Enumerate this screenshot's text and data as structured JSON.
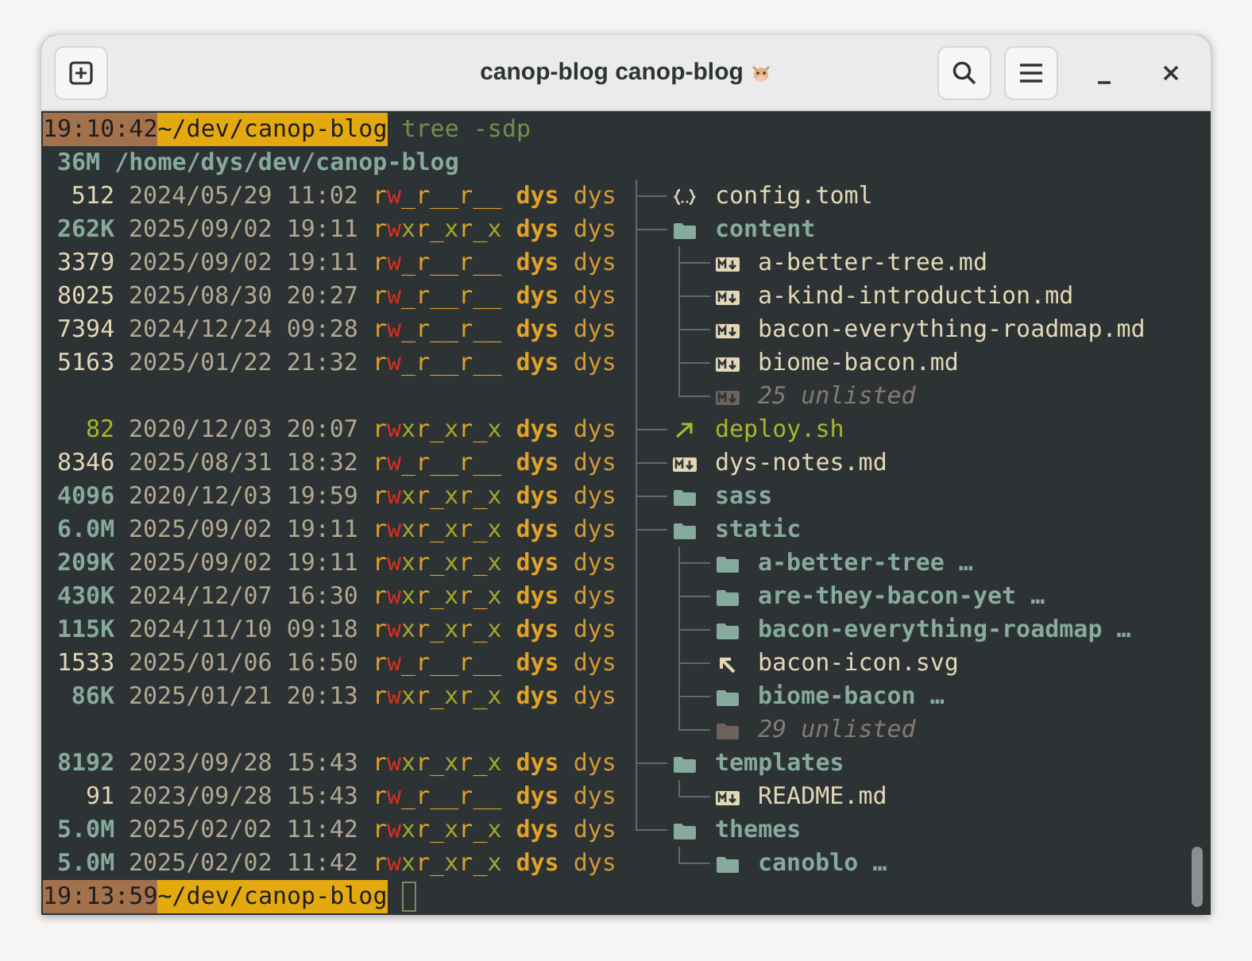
{
  "window": {
    "title": "canop-blog canop-blog"
  },
  "prompt": {
    "time": "19:10:42",
    "path": "~/dev/canop-blog",
    "command": "tree -sdp"
  },
  "listing": {
    "root": {
      "size": "36M",
      "path": "/home/dys/dev/canop-blog"
    },
    "entries": [
      {
        "size": "512",
        "date": "2024/05/29",
        "time": "11:02",
        "permissions": "rw_r__r__",
        "user": "dys",
        "group": "dys",
        "name": "config.toml",
        "kind": "config"
      },
      {
        "size": "262K",
        "date": "2025/09/02",
        "time": "19:11",
        "permissions": "rwxr_xr_x",
        "user": "dys",
        "group": "dys",
        "name": "content",
        "kind": "dir",
        "children": [
          {
            "size": "3379",
            "date": "2025/09/02",
            "time": "19:11",
            "permissions": "rw_r__r__",
            "user": "dys",
            "group": "dys",
            "name": "a-better-tree.md",
            "kind": "markdown"
          },
          {
            "size": "8025",
            "date": "2025/08/30",
            "time": "20:27",
            "permissions": "rw_r__r__",
            "user": "dys",
            "group": "dys",
            "name": "a-kind-introduction.md",
            "kind": "markdown"
          },
          {
            "size": "7394",
            "date": "2024/12/24",
            "time": "09:28",
            "permissions": "rw_r__r__",
            "user": "dys",
            "group": "dys",
            "name": "bacon-everything-roadmap.md",
            "kind": "markdown"
          },
          {
            "size": "5163",
            "date": "2025/01/22",
            "time": "21:32",
            "permissions": "rw_r__r__",
            "user": "dys",
            "group": "dys",
            "name": "biome-bacon.md",
            "kind": "markdown"
          },
          {
            "name": "25 unlisted",
            "kind": "unlisted-markdown"
          }
        ]
      },
      {
        "size": "82",
        "date": "2020/12/03",
        "time": "20:07",
        "permissions": "rwxr_xr_x",
        "user": "dys",
        "group": "dys",
        "name": "deploy.sh",
        "kind": "script"
      },
      {
        "size": "8346",
        "date": "2025/08/31",
        "time": "18:32",
        "permissions": "rw_r__r__",
        "user": "dys",
        "group": "dys",
        "name": "dys-notes.md",
        "kind": "markdown"
      },
      {
        "size": "4096",
        "date": "2020/12/03",
        "time": "19:59",
        "permissions": "rwxr_xr_x",
        "user": "dys",
        "group": "dys",
        "name": "sass",
        "kind": "dir"
      },
      {
        "size": "6.0M",
        "date": "2025/09/02",
        "time": "19:11",
        "permissions": "rwxr_xr_x",
        "user": "dys",
        "group": "dys",
        "name": "static",
        "kind": "dir",
        "children": [
          {
            "size": "209K",
            "date": "2025/09/02",
            "time": "19:11",
            "permissions": "rwxr_xr_x",
            "user": "dys",
            "group": "dys",
            "name": "a-better-tree …",
            "kind": "dir"
          },
          {
            "size": "430K",
            "date": "2024/12/07",
            "time": "16:30",
            "permissions": "rwxr_xr_x",
            "user": "dys",
            "group": "dys",
            "name": "are-they-bacon-yet …",
            "kind": "dir"
          },
          {
            "size": "115K",
            "date": "2024/11/10",
            "time": "09:18",
            "permissions": "rwxr_xr_x",
            "user": "dys",
            "group": "dys",
            "name": "bacon-everything-roadmap …",
            "kind": "dir"
          },
          {
            "size": "1533",
            "date": "2025/01/06",
            "time": "16:50",
            "permissions": "rw_r__r__",
            "user": "dys",
            "group": "dys",
            "name": "bacon-icon.svg",
            "kind": "image"
          },
          {
            "size": "86K",
            "date": "2025/01/21",
            "time": "20:13",
            "permissions": "rwxr_xr_x",
            "user": "dys",
            "group": "dys",
            "name": "biome-bacon …",
            "kind": "dir"
          },
          {
            "name": "29 unlisted",
            "kind": "unlisted-dir"
          }
        ]
      },
      {
        "size": "8192",
        "date": "2023/09/28",
        "time": "15:43",
        "permissions": "rwxr_xr_x",
        "user": "dys",
        "group": "dys",
        "name": "templates",
        "kind": "dir",
        "children": [
          {
            "size": "91",
            "date": "2023/09/28",
            "time": "15:43",
            "permissions": "rw_r__r__",
            "user": "dys",
            "group": "dys",
            "name": "README.md",
            "kind": "markdown"
          }
        ]
      },
      {
        "size": "5.0M",
        "date": "2025/02/02",
        "time": "11:42",
        "permissions": "rwxr_xr_x",
        "user": "dys",
        "group": "dys",
        "name": "themes",
        "kind": "dir",
        "children": [
          {
            "size": "5.0M",
            "date": "2025/02/02",
            "time": "11:42",
            "permissions": "rwxr_xr_x",
            "user": "dys",
            "group": "dys",
            "name": "canoblo …",
            "kind": "dir"
          }
        ]
      }
    ]
  },
  "final_prompt": {
    "time": "19:13:59",
    "path": "~/dev/canop-blog"
  }
}
